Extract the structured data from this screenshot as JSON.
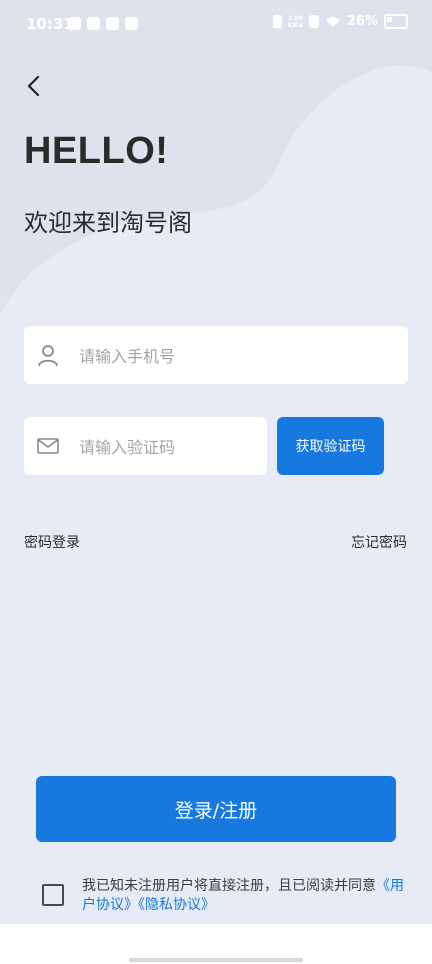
{
  "status_bar": {
    "time": "10:31",
    "speed_top": "2.00",
    "speed_bottom": "KB/s",
    "battery_text": "26%"
  },
  "header": {
    "hello": "HELLO!",
    "welcome": "欢迎来到淘号阁"
  },
  "form": {
    "phone_placeholder": "请输入手机号",
    "phone_value": "",
    "code_placeholder": "请输入验证码",
    "code_value": "",
    "get_code_label": "获取验证码"
  },
  "links": {
    "password_login": "密码登录",
    "forgot_password": "忘记密码"
  },
  "login_button": "登录/注册",
  "agreement": {
    "checked": false,
    "text": "我已知未注册用户将直接注册，且已阅读并同意",
    "user_agreement": "《用户协议》",
    "privacy_agreement": "《隐私协议》"
  },
  "colors": {
    "primary": "#1778df",
    "background": "#e7ebf5"
  },
  "icons": [
    "back-arrow-icon",
    "user-icon",
    "mail-icon"
  ]
}
